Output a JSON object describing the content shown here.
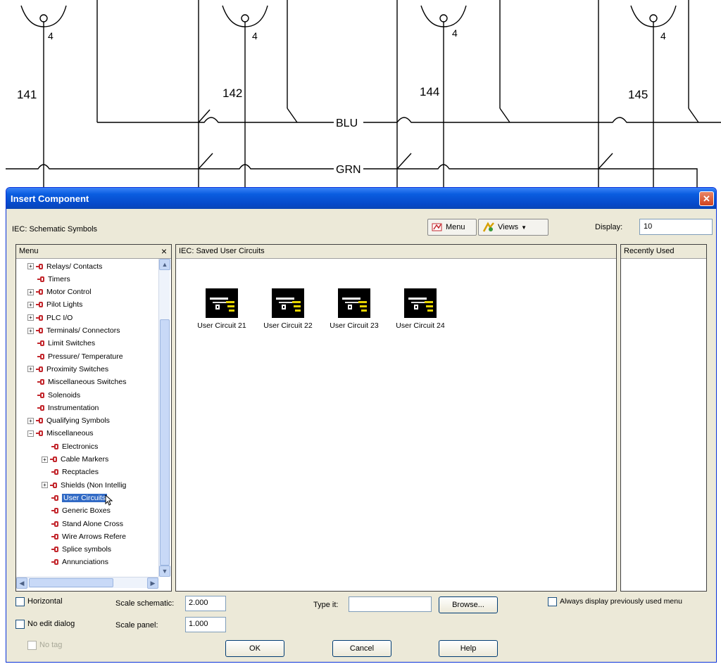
{
  "schematic": {
    "rung_numbers": [
      "141",
      "142",
      "144",
      "145"
    ],
    "coil_numbers": [
      "4",
      "4",
      "4",
      "4"
    ],
    "wire_labels": {
      "blue": "BLU",
      "green": "GRN"
    }
  },
  "dialog": {
    "title": "Insert Component",
    "close_glyph": "✕",
    "library_label": "IEC: Schematic Symbols",
    "toolbar": {
      "menu_label": "Menu",
      "views_label": "Views",
      "views_caret": "▼",
      "display_label": "Display:",
      "display_value": "10"
    },
    "menu_panel": {
      "title": "Menu",
      "close_glyph": "×",
      "items": [
        {
          "label": "Relays/ Contacts",
          "expander": "+"
        },
        {
          "label": "Timers"
        },
        {
          "label": "Motor Control",
          "expander": "+"
        },
        {
          "label": "Pilot Lights",
          "expander": "+"
        },
        {
          "label": "PLC I/O",
          "expander": "+"
        },
        {
          "label": "Terminals/ Connectors",
          "expander": "+"
        },
        {
          "label": "Limit Switches"
        },
        {
          "label": "Pressure/ Temperature"
        },
        {
          "label": "Proximity Switches",
          "expander": "+"
        },
        {
          "label": "Miscellaneous Switches"
        },
        {
          "label": "Solenoids"
        },
        {
          "label": "Instrumentation"
        },
        {
          "label": "Qualifying Symbols",
          "expander": "+"
        },
        {
          "label": "Miscellaneous",
          "expander": "−"
        },
        {
          "label": "Electronics",
          "child": true
        },
        {
          "label": "Cable Markers",
          "expander": "+",
          "child": true
        },
        {
          "label": "Recptacles",
          "child": true
        },
        {
          "label": "Shields (Non Intellig",
          "expander": "+",
          "child": true
        },
        {
          "label": "User Circuits",
          "child": true,
          "selected": true
        },
        {
          "label": "Generic Boxes",
          "child": true
        },
        {
          "label": "Stand Alone Cross",
          "child": true
        },
        {
          "label": "Wire Arrows Refere",
          "child": true
        },
        {
          "label": "Splice symbols",
          "child": true
        },
        {
          "label": "Annunciations",
          "child": true
        }
      ]
    },
    "scroll_glyphs": {
      "up": "▲",
      "down": "▼",
      "left": "◀",
      "right": "▶"
    },
    "content_panel": {
      "title": "IEC: Saved User Circuits",
      "items": [
        {
          "label": "User Circuit 21"
        },
        {
          "label": "User Circuit 22"
        },
        {
          "label": "User Circuit 23"
        },
        {
          "label": "User Circuit 24"
        }
      ]
    },
    "recent_panel": {
      "title": "Recently Used"
    },
    "options": {
      "horizontal_label": "Horizontal",
      "no_edit_dialog_label": "No edit dialog",
      "no_tag_label": "No tag",
      "scale_schematic_label": "Scale schematic:",
      "scale_schematic_value": "2.000",
      "scale_panel_label": "Scale panel:",
      "scale_panel_value": "1.000",
      "type_it_label": "Type it:",
      "type_it_value": "",
      "browse_label": "Browse...",
      "always_display_label": "Always display previously used menu"
    },
    "buttons": {
      "ok": "OK",
      "cancel": "Cancel",
      "help": "Help"
    }
  }
}
